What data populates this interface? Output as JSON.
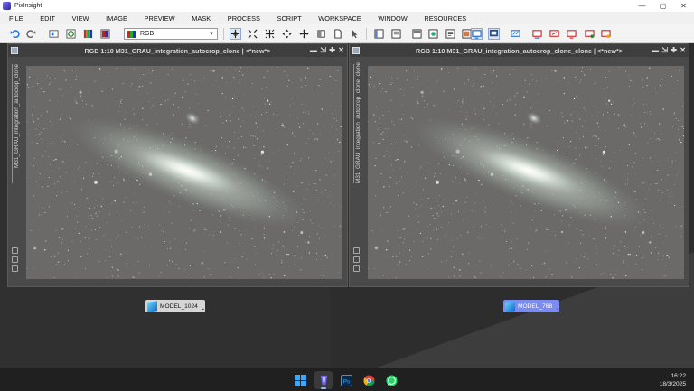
{
  "app": {
    "title": "PixInsight"
  },
  "window_controls": {
    "minimize": "—",
    "maximize": "▢",
    "close": "✕"
  },
  "menu": [
    "FILE",
    "EDIT",
    "VIEW",
    "IMAGE",
    "PREVIEW",
    "MASK",
    "PROCESS",
    "SCRIPT",
    "WORKSPACE",
    "WINDOW",
    "RESOURCES"
  ],
  "toolbar": {
    "color_mode": "RGB"
  },
  "image_windows": [
    {
      "title": "RGB 1:10 M31_GRAU_integration_autocrop_clone | <*new*>",
      "side_label": "M31_GRAU_integration_autocrop_clone",
      "controls": [
        "▬",
        "⇲",
        "✚",
        "✕"
      ]
    },
    {
      "title": "RGB 1:10 M31_GRAU_integration_autocrop_clone_clone | <*new*>",
      "side_label": "M31_GRAU_integration_autocrop_clone_clone",
      "controls": [
        "▬",
        "⇲",
        "✚",
        "✕"
      ]
    }
  ],
  "desktop_icons": [
    {
      "label": "MODEL_1024",
      "background": "#d6d6d6",
      "text_color": "#111111"
    },
    {
      "label": "MODEL_768",
      "background": "#7b8cf0",
      "text_color": "#ffffff"
    }
  ],
  "taskbar": {
    "apps": [
      "windows-start",
      "pixinsight",
      "photoshop",
      "chrome",
      "whatsapp"
    ],
    "photoshop_label": "Ps",
    "time": "16:22",
    "date": "18/3/2025"
  },
  "colors": {
    "accent": "#4aa0ff",
    "workspace": "#303030",
    "image_bg": "#6b6a68"
  }
}
